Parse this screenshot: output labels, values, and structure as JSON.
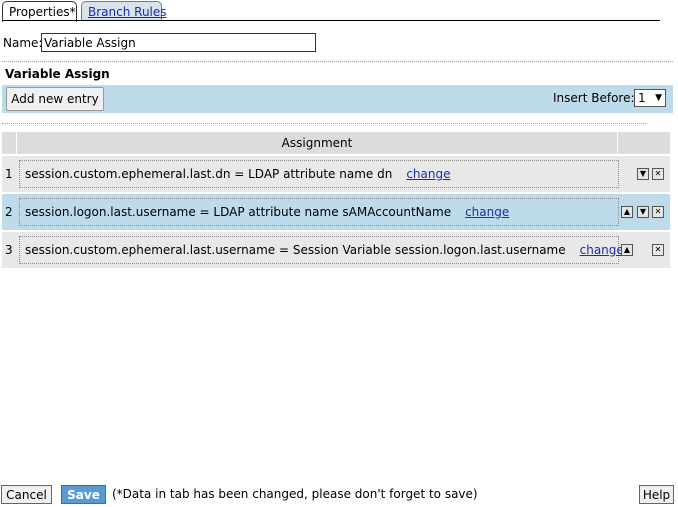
{
  "tabs": [
    {
      "label": "Properties*",
      "active": true
    },
    {
      "label": "Branch Rules",
      "active": false
    }
  ],
  "name_field": {
    "label": "Name:",
    "value": "Variable Assign"
  },
  "section_title": "Variable Assign",
  "toolbar": {
    "add_entry_label": "Add new entry",
    "insert_before_label": "Insert Before:",
    "insert_before_value": "1"
  },
  "table": {
    "header": "Assignment",
    "rows": [
      {
        "index": "1",
        "assignment": "session.custom.ephemeral.last.dn = LDAP attribute name dn",
        "link": "change"
      },
      {
        "index": "2",
        "assignment": "session.logon.last.username = LDAP attribute name sAMAccountName",
        "link": "change"
      },
      {
        "index": "3",
        "assignment": "session.custom.ephemeral.last.username = Session Variable session.logon.last.username",
        "link": "change"
      }
    ]
  },
  "footer": {
    "cancel_label": "Cancel",
    "save_label": "Save",
    "note": "(*Data in tab has been changed, please don't forget to save)",
    "help_label": "Help"
  },
  "icons": {
    "up": "arrow-up-icon",
    "down": "arrow-down-icon",
    "delete": "close-icon"
  },
  "colors": {
    "toolbar_bg": "#bddbeb",
    "selected_row_bg": "#bddbeb",
    "row_bg": "#e8e8e8",
    "save_bg": "#5a9ad4",
    "link": "#1c2fa8"
  }
}
